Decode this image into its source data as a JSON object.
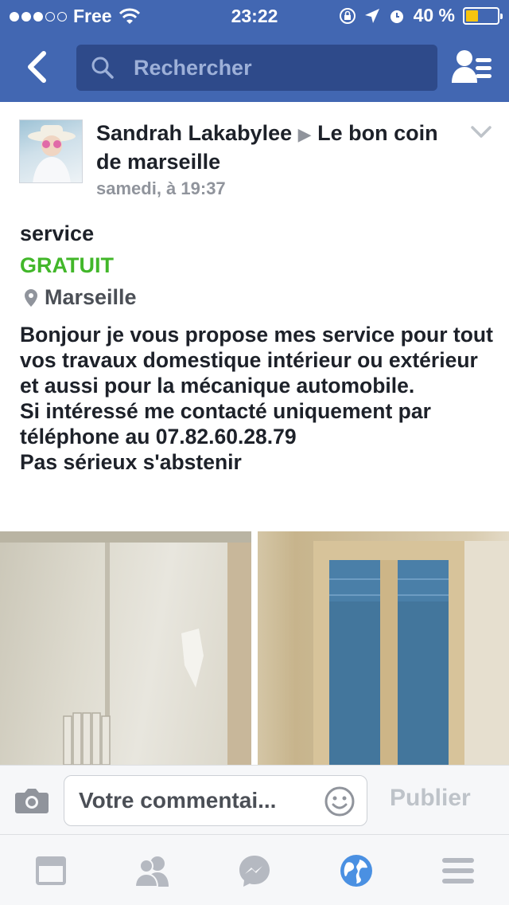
{
  "status_bar": {
    "carrier": "Free",
    "time": "23:22",
    "battery_percent": "40 %",
    "battery_level": 0.4
  },
  "nav": {
    "search_placeholder": "Rechercher"
  },
  "post": {
    "author": "Sandrah Lakabylee",
    "separator": "▶",
    "group": "Le bon coin de marseille",
    "timestamp": "samedi, à 19:37",
    "item_title": "service",
    "price": "GRATUIT",
    "location": "Marseille",
    "body": "Bonjour je vous propose mes service pour tout vos travaux domestique intérieur ou extérieur et aussi pour la mécanique automobile.\nSi intéressé me contacté uniquement par téléphone au 07.82.60.28.79\nPas sérieux s'abstenir"
  },
  "comment_bar": {
    "placeholder": "Votre commentai...",
    "publish_label": "Publier"
  },
  "tabs": [
    "news-feed-icon",
    "friends-icon",
    "messenger-icon",
    "globe-icon",
    "menu-icon"
  ],
  "colors": {
    "brand": "#4267b2",
    "price_green": "#42b72a",
    "meta_grey": "#90949c",
    "active_tab": "#4a90e2"
  }
}
